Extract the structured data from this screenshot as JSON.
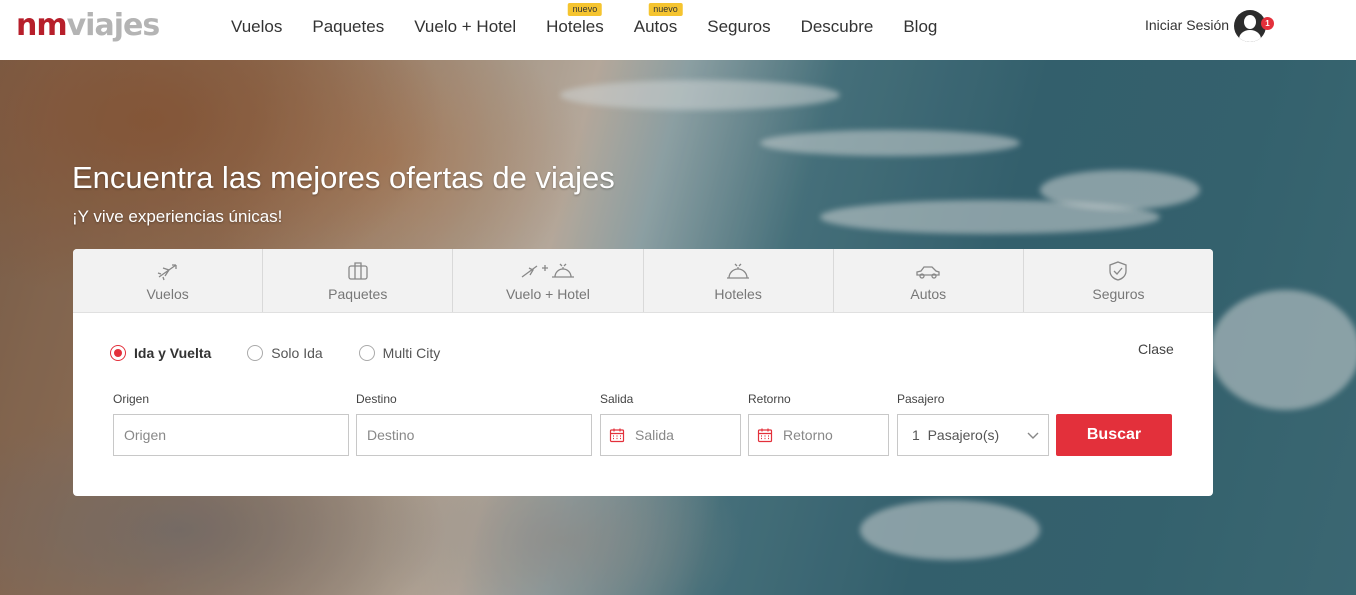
{
  "brand": {
    "logo_part1": "nm",
    "logo_part2": "viajes"
  },
  "nav": {
    "items": [
      {
        "label": "Vuelos",
        "badge": ""
      },
      {
        "label": "Paquetes",
        "badge": ""
      },
      {
        "label": "Vuelo + Hotel",
        "badge": ""
      },
      {
        "label": "Hoteles",
        "badge": "nuevo"
      },
      {
        "label": "Autos",
        "badge": "nuevo"
      },
      {
        "label": "Seguros",
        "badge": ""
      },
      {
        "label": "Descubre",
        "badge": ""
      },
      {
        "label": "Blog",
        "badge": ""
      }
    ],
    "login_label": "Iniciar Sesión",
    "notification_count": "1"
  },
  "hero": {
    "title": "Encuentra las mejores ofertas de viajes",
    "subtitle": "¡Y vive experiencias únicas!"
  },
  "search": {
    "tabs": [
      {
        "label": "Vuelos",
        "icon": "plane-icon"
      },
      {
        "label": "Paquetes",
        "icon": "suitcase-icon"
      },
      {
        "label": "Vuelo + Hotel",
        "icon": "plane-hotel-icon"
      },
      {
        "label": "Hoteles",
        "icon": "hotel-bell-icon"
      },
      {
        "label": "Autos",
        "icon": "car-icon"
      },
      {
        "label": "Seguros",
        "icon": "shield-icon"
      }
    ],
    "trip_types": [
      {
        "label": "Ida y Vuelta",
        "selected": true
      },
      {
        "label": "Solo Ida",
        "selected": false
      },
      {
        "label": "Multi City",
        "selected": false
      }
    ],
    "clase_label": "Clase",
    "fields": {
      "origen": {
        "label": "Origen",
        "placeholder": "Origen",
        "value": ""
      },
      "destino": {
        "label": "Destino",
        "placeholder": "Destino",
        "value": ""
      },
      "salida": {
        "label": "Salida",
        "placeholder": "Salida",
        "value": ""
      },
      "retorno": {
        "label": "Retorno",
        "placeholder": "Retorno",
        "value": ""
      },
      "pasajero": {
        "label": "Pasajero",
        "value": "1  Pasajero(s)"
      }
    },
    "submit_label": "Buscar"
  },
  "colors": {
    "brand_red": "#b71f2b",
    "accent_red": "#e3303b",
    "badge_yellow": "#f5c42f"
  }
}
